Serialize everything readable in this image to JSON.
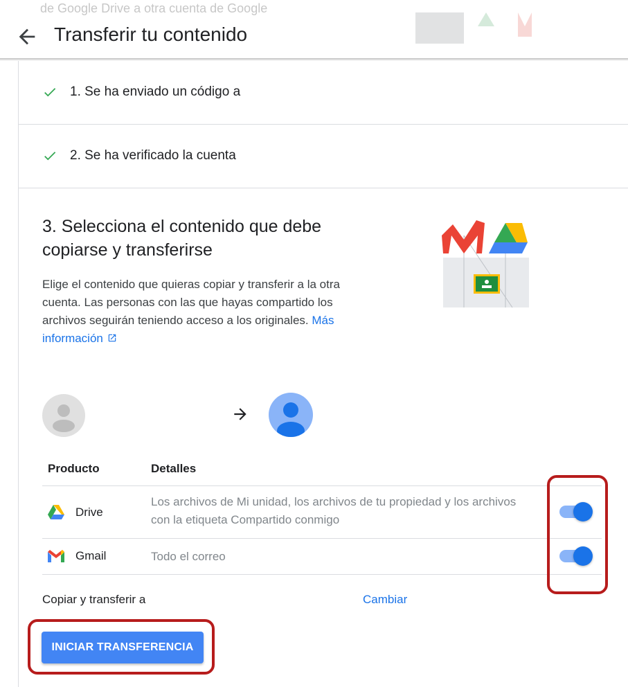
{
  "background": {
    "faded_text": "de Google Drive a otra cuenta de Google"
  },
  "header": {
    "back_icon": "arrow-back-icon",
    "title": "Transferir tu contenido"
  },
  "steps": [
    {
      "label": "1. Se ha enviado un código a",
      "icon": "check-icon"
    },
    {
      "label": "2. Se ha verificado la cuenta",
      "icon": "check-icon"
    }
  ],
  "step3": {
    "title": "3. Selecciona el contenido que debe copiarse y transferirse",
    "description": "Elige el contenido que quieras copiar y transferir a la otra cuenta. Las personas con las que hayas compartido los archivos seguirán teniendo acceso a los originales.",
    "more_info_link": "Más información"
  },
  "table": {
    "headers": {
      "product": "Producto",
      "details": "Detalles"
    },
    "rows": [
      {
        "product": "Drive",
        "details": "Los archivos de Mi unidad, los archivos de tu propiedad y los archivos con la etiqueta Compartido conmigo",
        "enabled": true,
        "icon": "google-drive-icon"
      },
      {
        "product": "Gmail",
        "details": "Todo el correo",
        "enabled": true,
        "icon": "gmail-icon"
      }
    ]
  },
  "transfer": {
    "copy_to_label": "Copiar y transferir a",
    "change_link": "Cambiar",
    "start_button": "INICIAR TRANSFERENCIA"
  },
  "colors": {
    "accent": "#1a73e8",
    "button": "#4285f4",
    "check": "#34a853",
    "highlight": "#b71c1c"
  }
}
